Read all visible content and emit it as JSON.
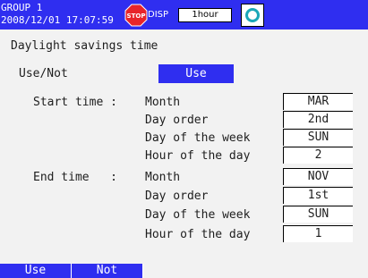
{
  "status_bar": {
    "group_label": "GROUP 1",
    "datetime": "2008/12/01 17:07:59",
    "disp_label": "DISP",
    "interval": "1hour",
    "stop_icon": "stop-icon",
    "refresh_icon": "refresh-icon"
  },
  "screen": {
    "title": "Daylight savings time",
    "use_not_label": "Use/Not",
    "use_not_value": "Use"
  },
  "start_time": {
    "label": "Start time :",
    "rows": [
      {
        "label": "Month",
        "value": "MAR"
      },
      {
        "label": "Day order",
        "value": "2nd"
      },
      {
        "label": "Day of the week",
        "value": "SUN"
      },
      {
        "label": "Hour of the day",
        "value": "2"
      }
    ]
  },
  "end_time": {
    "label": "End time   :",
    "rows": [
      {
        "label": "Month",
        "value": "NOV"
      },
      {
        "label": "Day order",
        "value": "1st"
      },
      {
        "label": "Day of the week",
        "value": "SUN"
      },
      {
        "label": "Hour of the day",
        "value": "1"
      }
    ]
  },
  "softkeys": [
    "Use",
    "Not"
  ],
  "colors": {
    "accent": "#2f2ef0",
    "background": "#f2f2f2"
  }
}
